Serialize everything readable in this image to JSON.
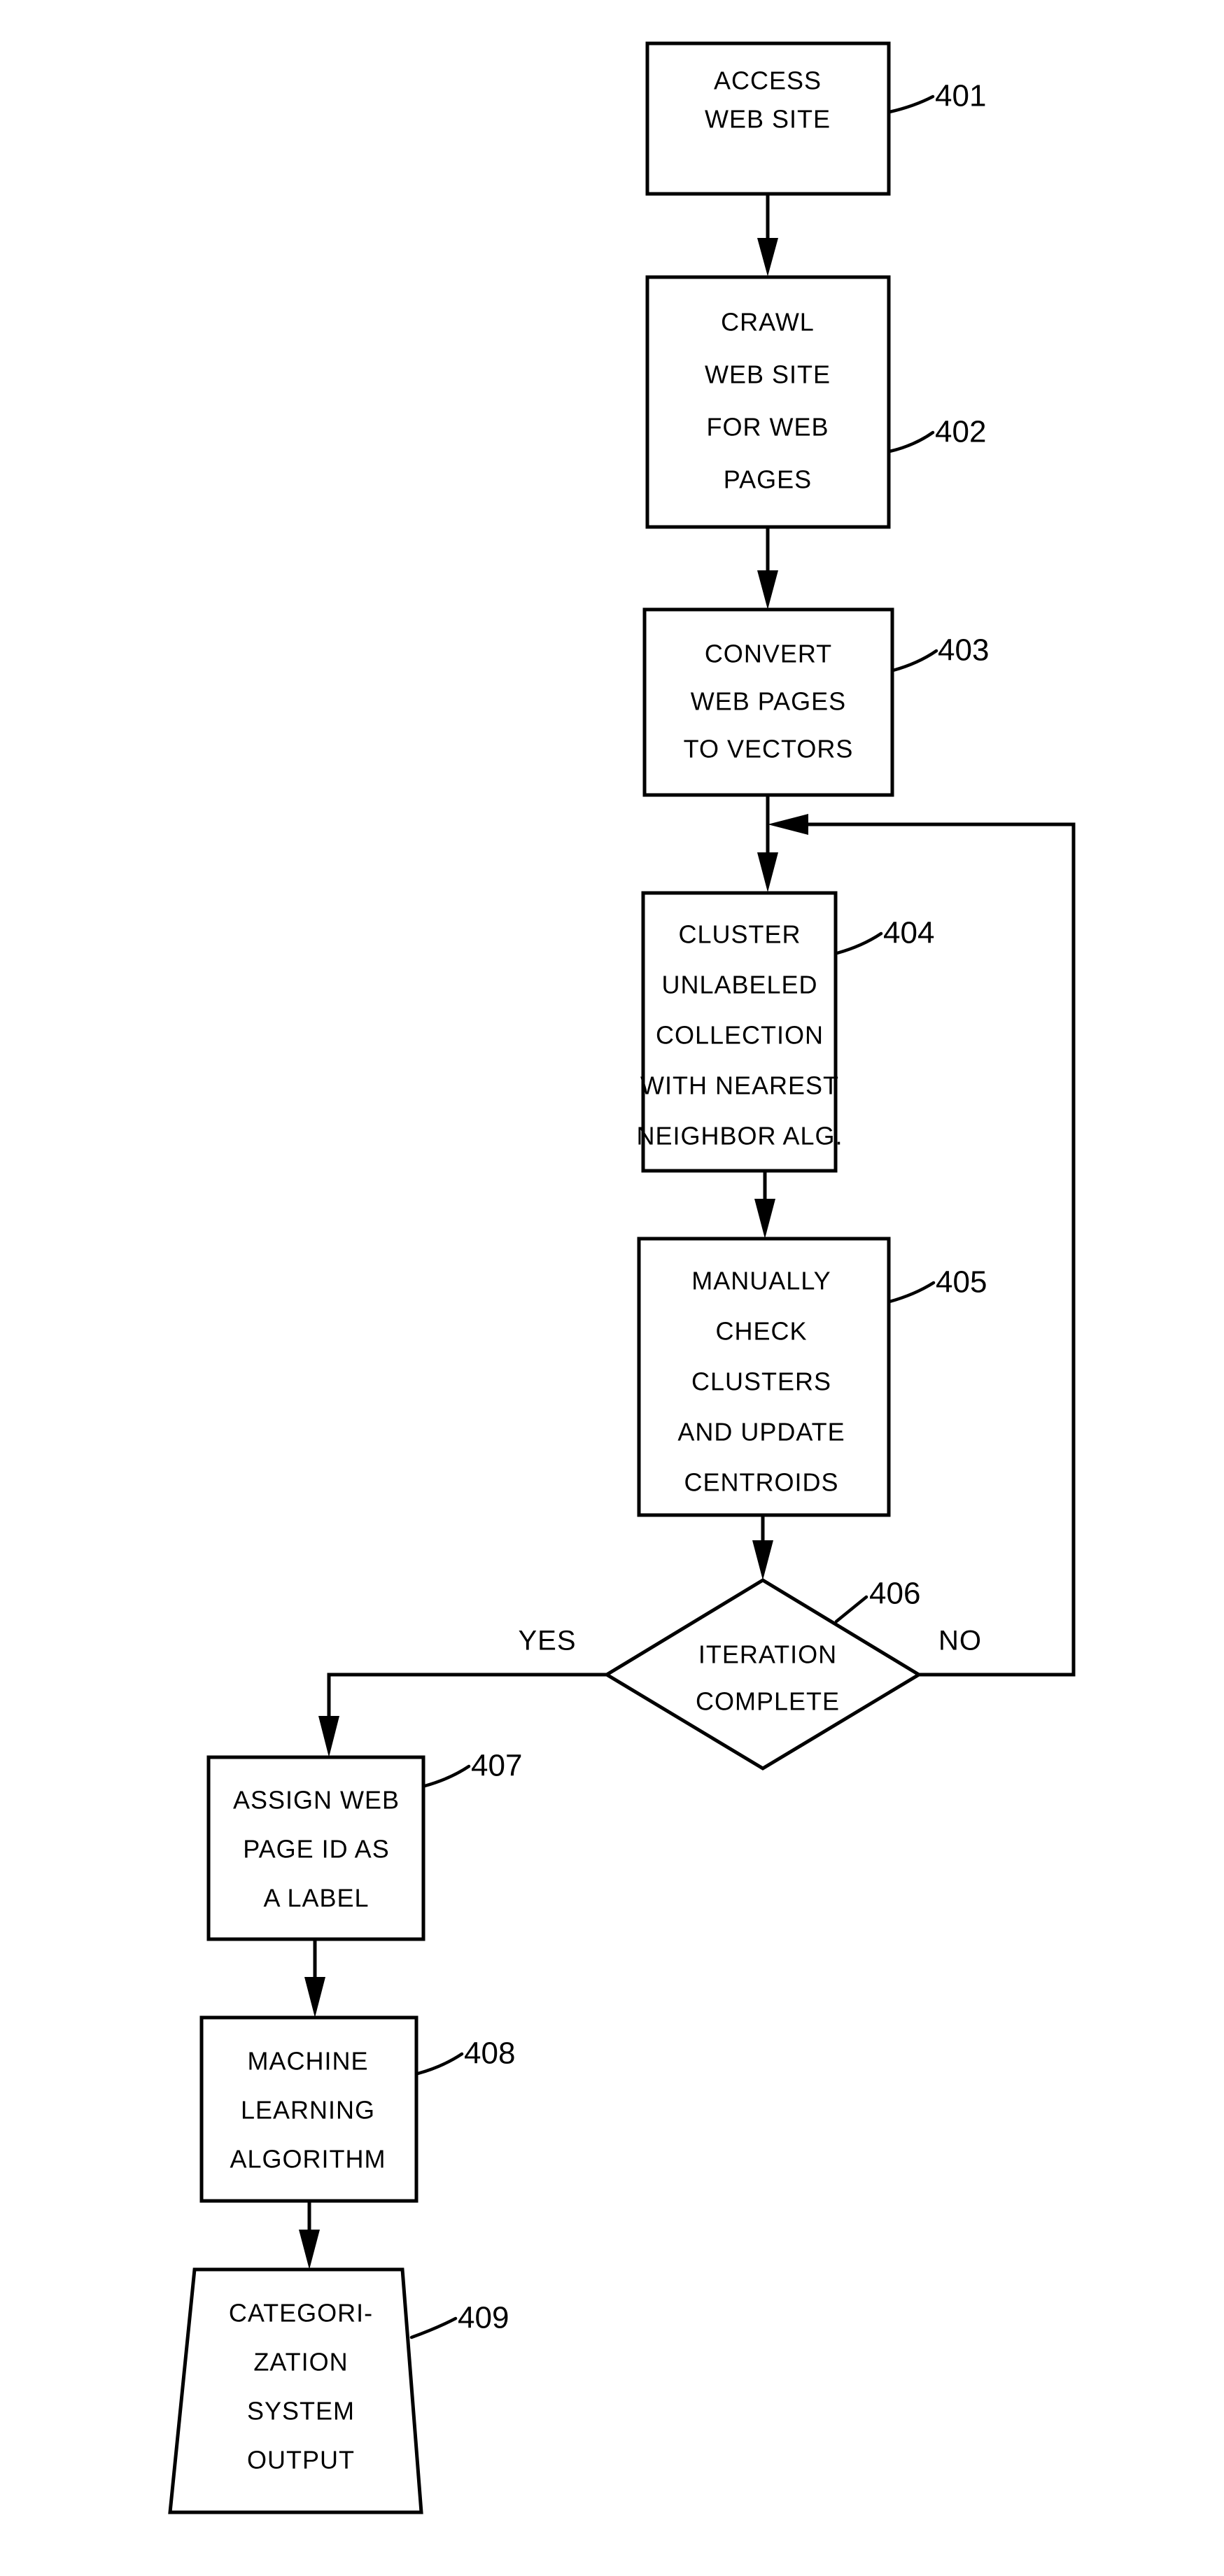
{
  "figure": {
    "type": "flowchart",
    "title": "Web page categorization process flowchart",
    "background_color": "#ffffff",
    "line_color": "#000000"
  },
  "nodes": [
    {
      "id": "401",
      "shape": "process",
      "ref": "401",
      "lines": [
        "ACCESS",
        "WEB SITE"
      ]
    },
    {
      "id": "402",
      "shape": "process",
      "ref": "402",
      "lines": [
        "CRAWL",
        "WEB SITE",
        "FOR WEB",
        "PAGES"
      ]
    },
    {
      "id": "403",
      "shape": "process",
      "ref": "403",
      "lines": [
        "CONVERT",
        "WEB PAGES",
        "TO VECTORS"
      ]
    },
    {
      "id": "404",
      "shape": "process",
      "ref": "404",
      "lines": [
        "CLUSTER",
        "UNLABELED",
        "COLLECTION",
        "WITH NEAREST",
        "NEIGHBOR ALG."
      ]
    },
    {
      "id": "405",
      "shape": "process",
      "ref": "405",
      "lines": [
        "MANUALLY",
        "CHECK",
        "CLUSTERS",
        "AND UPDATE",
        "CENTROIDS"
      ]
    },
    {
      "id": "406",
      "shape": "decision",
      "ref": "406",
      "lines": [
        "ITERATION",
        "COMPLETE"
      ]
    },
    {
      "id": "407",
      "shape": "process",
      "ref": "407",
      "lines": [
        "ASSIGN WEB",
        "PAGE ID AS",
        "A LABEL"
      ]
    },
    {
      "id": "408",
      "shape": "process",
      "ref": "408",
      "lines": [
        "MACHINE",
        "LEARNING",
        "ALGORITHM"
      ]
    },
    {
      "id": "409",
      "shape": "data-parallelogram",
      "ref": "409",
      "lines": [
        "CATEGORI-",
        "ZATION",
        "SYSTEM",
        "OUTPUT"
      ]
    }
  ],
  "branch_labels": {
    "yes": "YES",
    "no": "NO"
  },
  "edges": [
    {
      "from": "401",
      "to": "402",
      "label": ""
    },
    {
      "from": "402",
      "to": "403",
      "label": ""
    },
    {
      "from": "403",
      "to": "404",
      "label": ""
    },
    {
      "from": "404",
      "to": "405",
      "label": ""
    },
    {
      "from": "405",
      "to": "406",
      "label": ""
    },
    {
      "from": "406",
      "to": "407",
      "label": "YES"
    },
    {
      "from": "406",
      "to": "404",
      "label": "NO"
    },
    {
      "from": "407",
      "to": "408",
      "label": ""
    },
    {
      "from": "408",
      "to": "409",
      "label": ""
    }
  ]
}
